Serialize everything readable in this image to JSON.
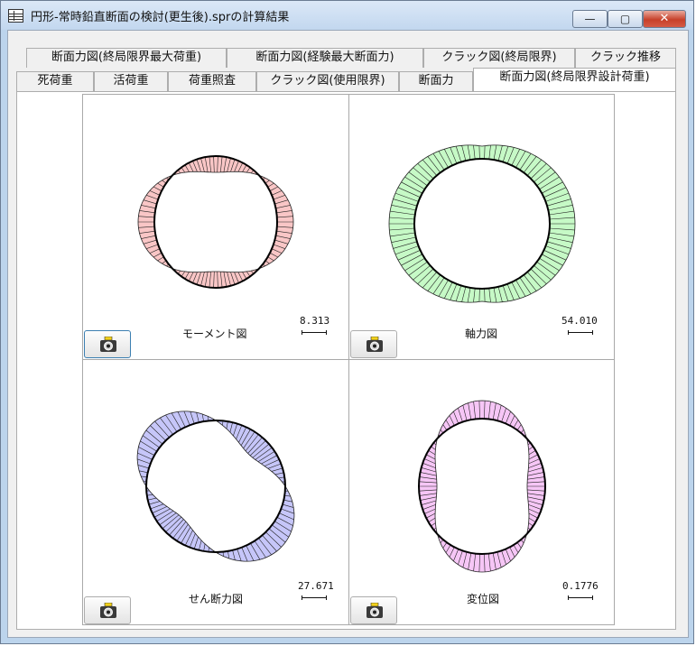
{
  "window": {
    "title": "円形-常時鉛直断面の検討(更生後).sprの計算結果",
    "controls": {
      "minimize": "—",
      "maximize": "▢",
      "close": "✕"
    }
  },
  "tabs": {
    "row1": [
      "断面力図(終局限界最大荷重)",
      "断面力図(経験最大断面力)",
      "クラック図(終局限界)",
      "クラック推移"
    ],
    "row2": [
      "死荷重",
      "活荷重",
      "荷重照査",
      "クラック図(使用限界)",
      "断面力",
      "断面力図(終局限界設計荷重)"
    ],
    "active": "断面力図(終局限界設計荷重)"
  },
  "diagrams": {
    "moment": {
      "label": "モーメント図",
      "scale": "8.313",
      "fill": "#f9c6c6"
    },
    "axial": {
      "label": "軸力図",
      "scale": "54.010",
      "fill": "#c6f9c6"
    },
    "shear": {
      "label": "せん断力図",
      "scale": "27.671",
      "fill": "#c6c6f9"
    },
    "displacement": {
      "label": "変位図",
      "scale": "0.1776",
      "fill": "#f6c6f6"
    }
  },
  "camera_button": {
    "icon": "camera-icon"
  }
}
